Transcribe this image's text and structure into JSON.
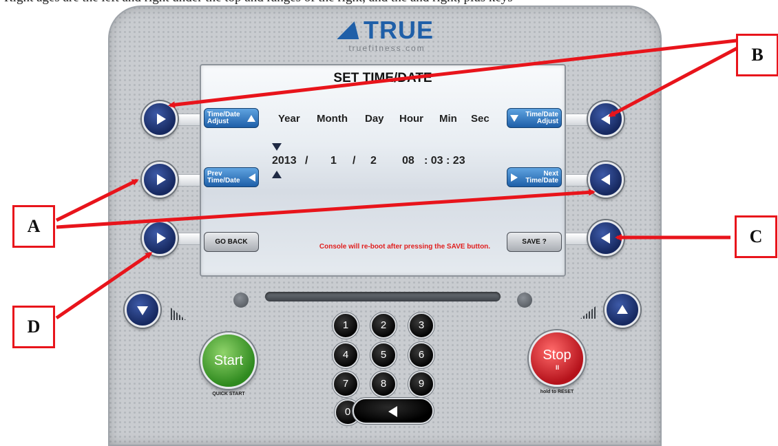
{
  "top_text": "Right ages are the left and right under the top and ranges of the right, and the and right, plus keys",
  "logo": {
    "brand": "TRUE",
    "url": "truefitness.com"
  },
  "screen": {
    "title": "SET TIME/DATE",
    "columns": [
      "Year",
      "Month",
      "Day",
      "Hour",
      "Min",
      "Sec"
    ],
    "values": {
      "year": "2013",
      "sep1": "/",
      "month": "1",
      "sep2": "/",
      "day": "2",
      "hour": "08",
      "sep3": ": 03 : 23"
    },
    "warning": "Console will re-boot after pressing the SAVE button.",
    "softkeys": {
      "time_date_adjust_left": {
        "line1": "Time/Date",
        "line2": "Adjust"
      },
      "prev_time_date": {
        "line1": "Prev",
        "line2": "Time/Date"
      },
      "go_back": "GO BACK",
      "time_date_adjust_right": {
        "line1": "Time/Date",
        "line2": "Adjust"
      },
      "next_time_date": {
        "line1": "Next",
        "line2": "Time/Date"
      },
      "save": "SAVE ?"
    }
  },
  "keypad": {
    "keys": [
      "1",
      "2",
      "3",
      "4",
      "5",
      "6",
      "7",
      "8",
      "9",
      "0"
    ]
  },
  "start": {
    "label": "Start",
    "caption": "QUICK START"
  },
  "stop": {
    "label": "Stop",
    "pause_glyph": "II",
    "caption": "hold to RESET"
  },
  "callouts": {
    "a": "A",
    "b": "B",
    "c": "C",
    "d": "D"
  },
  "icons": [
    "right-triangle-icon",
    "left-triangle-icon",
    "up-triangle-icon",
    "down-triangle-icon",
    "incline-down-icon",
    "incline-up-icon",
    "backspace-icon",
    "pause-icon"
  ],
  "colors": {
    "screen_button_blue": "#1e5fa8",
    "round_button_navy": "#16285f",
    "start_green": "#2f8a1f",
    "stop_red": "#b5121b",
    "annotation_red": "#e8141b",
    "logo_blue": "#1f5fa8"
  }
}
